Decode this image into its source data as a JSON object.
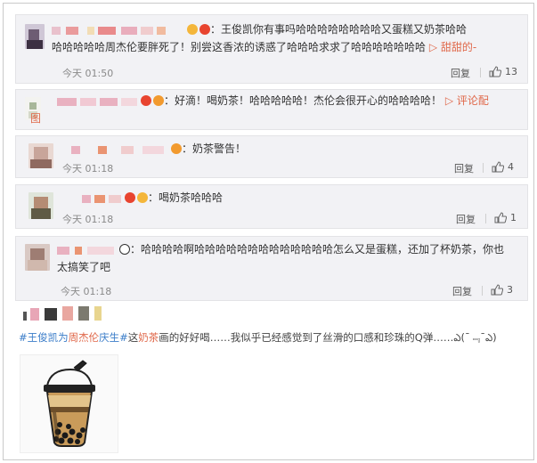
{
  "comments": [
    {
      "text": "：王俊凯你有事吗哈哈哈哈哈哈哈哈又蛋糕又奶茶哈哈",
      "text2": "哈哈哈哈哈周杰伦要胖死了！别尝这香浓的诱惑了哈哈哈求求了哈哈哈哈哈哈哈",
      "tail": "▷ 甜甜的-",
      "time": "今天 01:50",
      "reply_label": "回复",
      "likes": "13"
    },
    {
      "text": "：好滴！喝奶茶！哈哈哈哈哈！杰伦会很开心的哈哈哈哈！",
      "tail": "▷ 评论配",
      "text2": "图"
    },
    {
      "text": "：奶茶警告！",
      "time": "今天 01:18",
      "reply_label": "回复",
      "likes": "4"
    },
    {
      "text": "：喝奶茶哈哈哈",
      "time": "今天 01:18",
      "reply_label": "回复",
      "likes": "1"
    },
    {
      "text": "：哈哈哈哈啊哈哈哈哈哈哈哈哈哈哈哈哈哈怎么又是蛋糕，还加了杯奶茶，你也",
      "text2": "太搞笑了吧",
      "time": "今天 01:18",
      "reply_label": "回复",
      "likes": "3"
    }
  ],
  "post": {
    "tag_open": "#王俊凯为",
    "tag_hl1": "周杰伦",
    "tag_mid": "庆生#",
    "text_a": "这",
    "tag_hl2": "奶茶",
    "text_b": "画的好好喝……我似乎已经感觉到了丝滑的口感和珍珠的Q弹……ఎ(¯﹃¯ఎ)"
  },
  "colors": {
    "accent_link": "#3c7ec9",
    "accent_orange": "#e0694b",
    "card_bg": "#f2f2f5"
  },
  "icons": [
    "thumb-up-icon",
    "play-icon",
    "panda-emoji-icon"
  ]
}
